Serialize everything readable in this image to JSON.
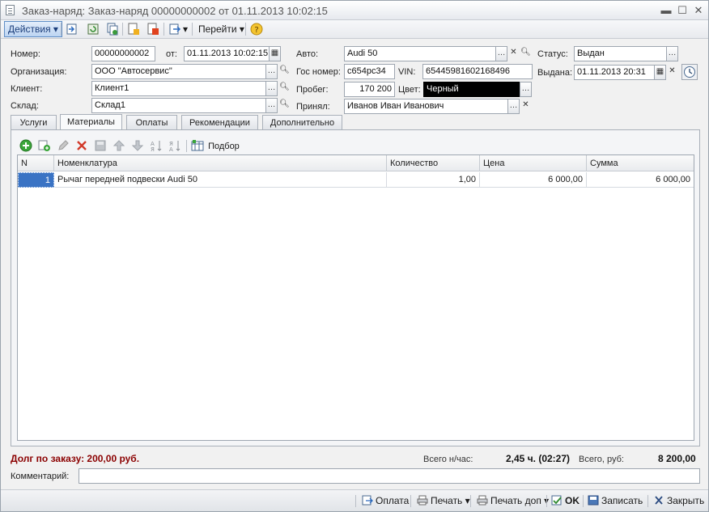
{
  "window": {
    "title": "Заказ-наряд: Заказ-наряд 00000000002 от 01.11.2013 10:02:15"
  },
  "toolbar": {
    "actions_label": "Действия",
    "goto_label": "Перейти"
  },
  "form": {
    "number_label": "Номер:",
    "number_value": "00000000002",
    "date_label": "от:",
    "date_value": "01.11.2013 10:02:15",
    "org_label": "Организация:",
    "org_value": "ООО \"Автосервис\"",
    "client_label": "Клиент:",
    "client_value": "Клиент1",
    "warehouse_label": "Склад:",
    "warehouse_value": "Склад1",
    "auto_label": "Авто:",
    "auto_value": "Audi 50",
    "plate_label": "Гос номер:",
    "plate_value": "с654рс34",
    "vin_label": "VIN:",
    "vin_value": "65445981602168496",
    "mileage_label": "Пробег:",
    "mileage_value": "170 200",
    "color_label": "Цвет:",
    "color_value": "Черный",
    "accepted_label": "Принял:",
    "accepted_value": "Иванов Иван Иванович",
    "status_label": "Статус:",
    "status_value": "Выдан",
    "issued_label": "Выдана:",
    "issued_value": "01.11.2013 20:31"
  },
  "tabs": [
    {
      "label": "Услуги"
    },
    {
      "label": "Материалы"
    },
    {
      "label": "Оплаты"
    },
    {
      "label": "Рекомендации"
    },
    {
      "label": "Дополнительно"
    }
  ],
  "materials": {
    "pick_label": "Подбор",
    "columns": [
      "N",
      "Номенклатура",
      "Количество",
      "Цена",
      "Сумма"
    ],
    "rows": [
      {
        "n": "1",
        "item": "Рычаг передней подвески Audi 50",
        "qty": "1,00",
        "price": "6 000,00",
        "sum": "6 000,00"
      }
    ]
  },
  "footer": {
    "debt": "Долг по заказу: 200,00 руб.",
    "hours_label": "Всего н/час:",
    "hours_value": "2,45 ч. (02:27)",
    "total_label": "Всего, руб:",
    "total_value": "8 200,00",
    "comment_label": "Комментарий:",
    "comment_value": ""
  },
  "bottom": {
    "payment": "Оплата",
    "print": "Печать",
    "print_extra": "Печать доп",
    "ok": "OK",
    "save": "Записать",
    "close": "Закрыть"
  },
  "colors": {
    "accent": "#3a73c4",
    "debt": "#8b0000"
  }
}
